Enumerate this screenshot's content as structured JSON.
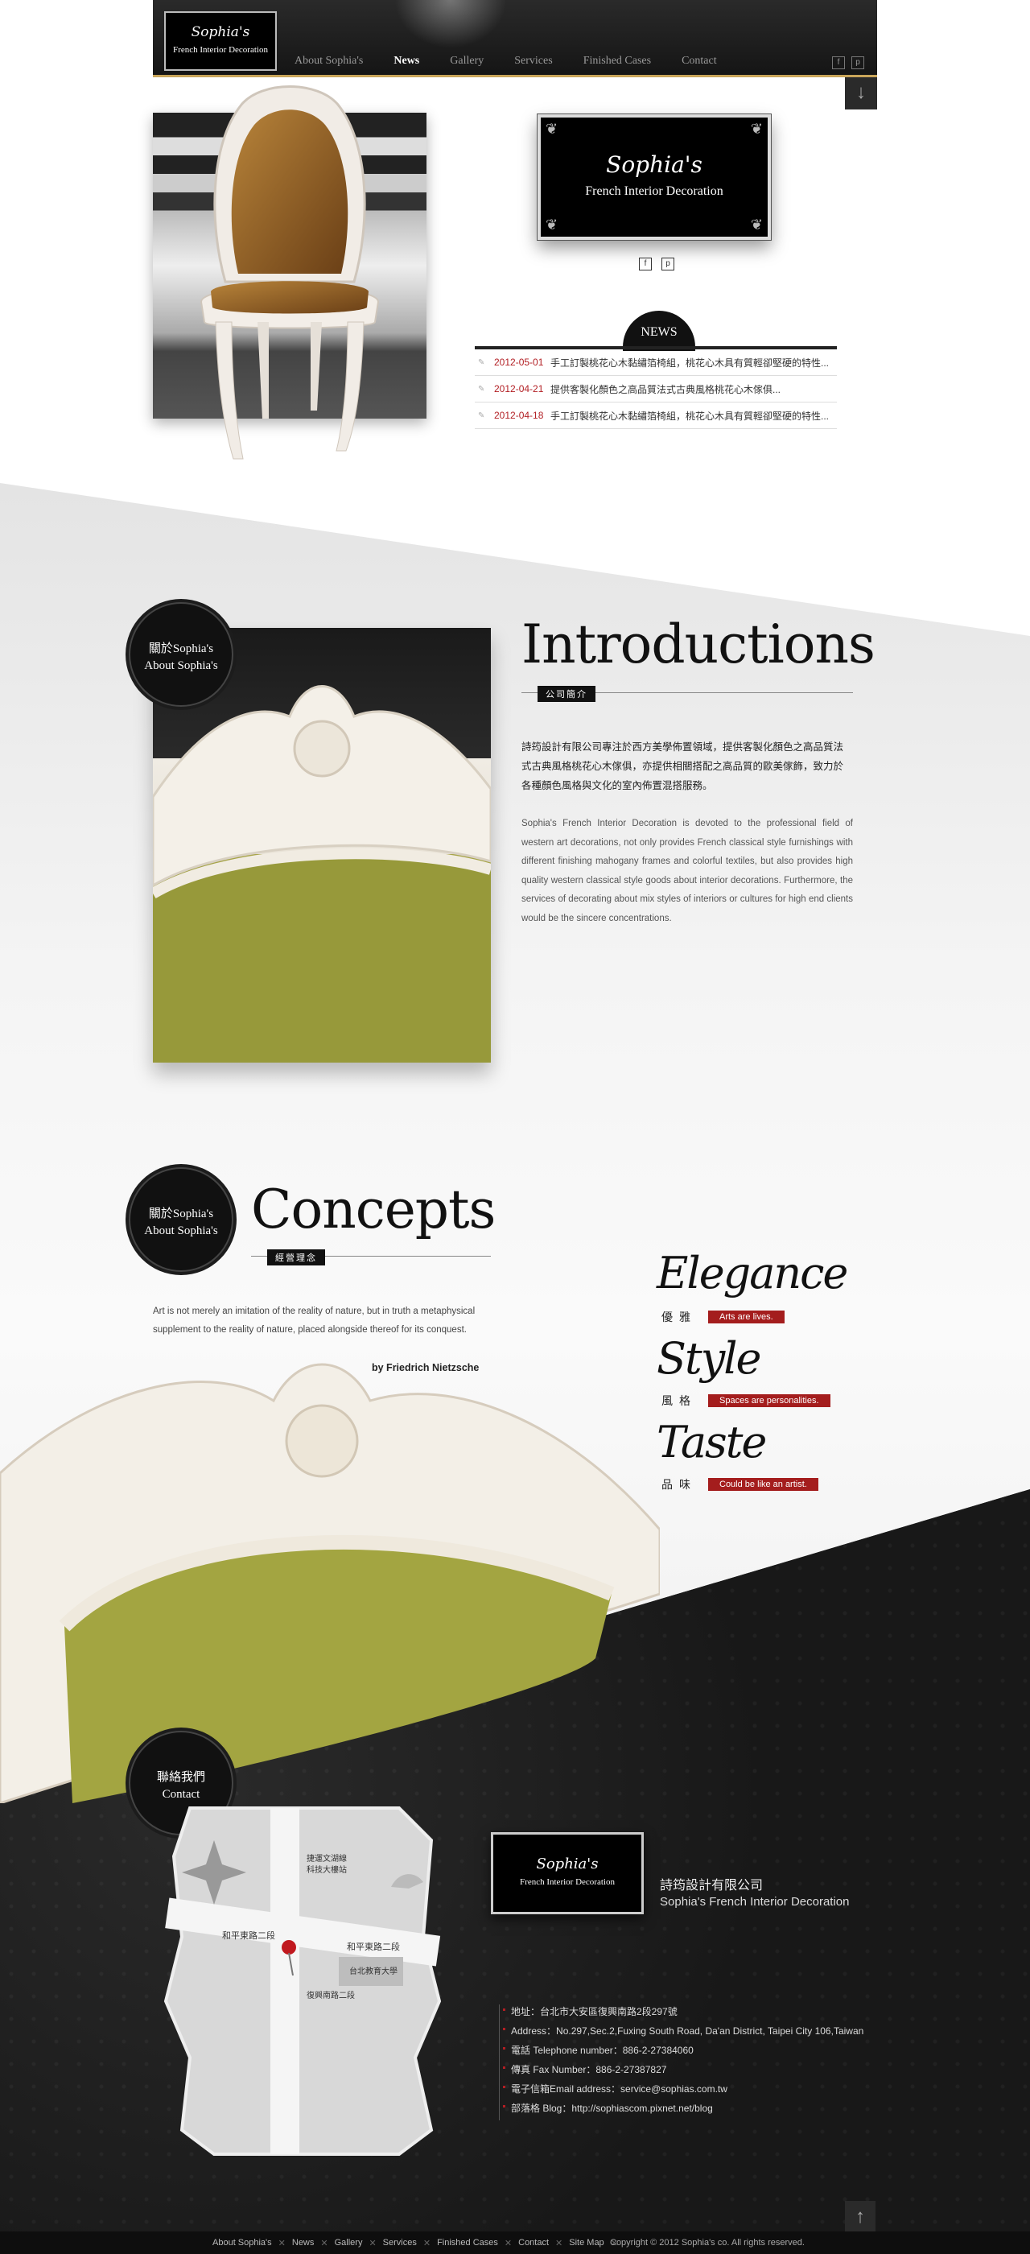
{
  "nav": {
    "logo_script": "Sophia's",
    "logo_sub": "French Interior Decoration",
    "items": [
      {
        "label": "About Sophia's",
        "active": false
      },
      {
        "label": "News",
        "active": true
      },
      {
        "label": "Gallery",
        "active": false
      },
      {
        "label": "Services",
        "active": false
      },
      {
        "label": "Finished Cases",
        "active": false
      },
      {
        "label": "Contact",
        "active": false
      }
    ],
    "social_icons": [
      "facebook-icon",
      "plurk-icon"
    ],
    "scroll_icon": "arrow-down-icon"
  },
  "hero": {
    "logo_script": "Sophia's",
    "logo_sub": "French Interior Decoration",
    "social_icons": [
      "facebook-icon",
      "plurk-icon"
    ]
  },
  "news": {
    "badge": "NEWS",
    "items": [
      {
        "date": "2012-05-01",
        "title": "手工訂製桃花心木黏繡箔椅組，桃花心木具有質輕卻堅硬的特性..."
      },
      {
        "date": "2012-04-21",
        "title": "提供客製化顏色之高品質法式古典風格桃花心木傢俱..."
      },
      {
        "date": "2012-04-18",
        "title": "手工訂製桃花心木黏繡箔椅組，桃花心木具有質輕卻堅硬的特性..."
      }
    ]
  },
  "about": {
    "badge_zh": "關於Sophia's",
    "badge_en": "About Sophia's",
    "title": "Introductions",
    "tag": "公司簡介",
    "text_zh": "詩筠設計有限公司專注於西方美學佈置領域，提供客製化顏色之高品質法式古典風格桃花心木傢俱，亦提供相關搭配之高品質的歐美傢飾，致力於各種顏色風格與文化的室內佈置混搭服務。",
    "text_en": "Sophia's French Interior Decoration is devoted to the professional field of western art decorations, not only provides French classical style furnishings with different finishing mahogany frames and colorful textiles, but also provides high quality western classical style goods about interior decorations. Furthermore, the services of decorating about mix styles of interiors or cultures for high end clients would be the sincere concentrations."
  },
  "concepts": {
    "badge_zh": "關於Sophia's",
    "badge_en": "About Sophia's",
    "title": "Concepts",
    "tag": "經營理念",
    "quote": "Art is not merely an imitation of the reality of nature, but in truth a metaphysical supplement to the reality of nature, placed alongside thereof for its conquest.",
    "author": "by Friedrich Nietzsche",
    "values": [
      {
        "word": "Elegance",
        "zh": "優雅",
        "slogan": "Arts are lives."
      },
      {
        "word": "Style",
        "zh": "風格",
        "slogan": "Spaces are personalities."
      },
      {
        "word": "Taste",
        "zh": "品味",
        "slogan": "Could be like an artist."
      }
    ]
  },
  "contact": {
    "badge_zh": "聯絡我們",
    "badge_en": "Contact",
    "logo_script": "Sophia's",
    "logo_sub": "French Interior Decoration",
    "company_zh": "詩筠設計有限公司",
    "company_en": "Sophia's French Interior Decoration",
    "map_labels": {
      "mrt": "捷運文湖線",
      "mrt2": "科技大樓站",
      "road1": "和平東路二段",
      "road2": "和平東路二段",
      "road3": "復興南路二段",
      "school": "台北教育大學"
    },
    "lines": [
      "地址：台北市大安區復興南路2段297號",
      "Address：No.297,Sec.2,Fuxing South Road, Da'an District, Taipei City 106,Taiwan",
      "電話 Telephone number：886-2-27384060",
      "傳真 Fax Number：886-2-27387827",
      "電子信箱Email address：service@sophias.com.tw",
      "部落格 Blog：http://sophiascom.pixnet.net/blog"
    ],
    "scroll_icon": "arrow-up-icon"
  },
  "footer": {
    "links": [
      "About Sophia's",
      "News",
      "Gallery",
      "Services",
      "Finished Cases",
      "Contact",
      "Site Map"
    ],
    "copyright": "Copyright © 2012  Sophia's co. All rights reserved."
  },
  "colors": {
    "accent_red": "#b21e23",
    "gold": "#c9a55a",
    "dark": "#1c1c1c"
  }
}
